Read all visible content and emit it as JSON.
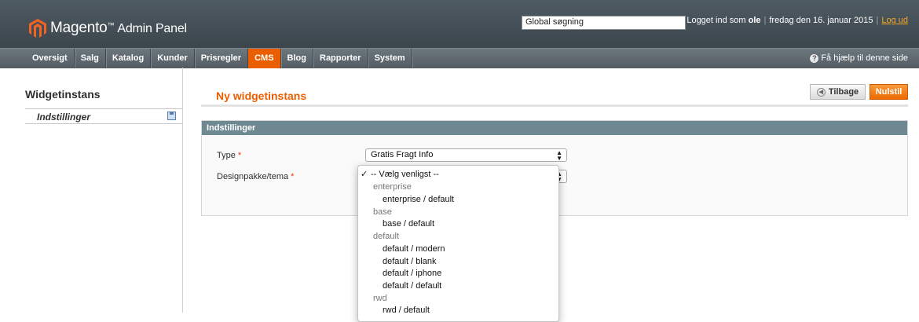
{
  "header": {
    "brand": "Magento",
    "brand_tm": "™",
    "brand_panel": "Admin Panel",
    "search_value": "Global søgning",
    "logged_in_prefix": "Logget ind som",
    "username": "ole",
    "date": "fredag den 16. januar 2015",
    "separator": "|",
    "logout": "Log ud"
  },
  "nav": {
    "items": [
      "Oversigt",
      "Salg",
      "Katalog",
      "Kunder",
      "Prisregler",
      "CMS",
      "Blog",
      "Rapporter",
      "System"
    ],
    "active": "CMS",
    "help": "Få hjælp til denne side"
  },
  "sidebar": {
    "title": "Widgetinstans",
    "tab_label": "Indstillinger"
  },
  "main": {
    "title": "Ny widgetinstans",
    "back_label": "Tilbage",
    "reset_label": "Nulstil",
    "fieldset_title": "Indstillinger",
    "type_label": "Type",
    "type_value": "Gratis Fragt Info",
    "design_label": "Designpakke/tema",
    "required_mark": "*"
  },
  "dropdown": {
    "check": "✓",
    "options": [
      {
        "text": "-- Vælg venligst --",
        "kind": "selected"
      },
      {
        "text": "enterprise",
        "kind": "group"
      },
      {
        "text": "enterprise / default",
        "kind": "option"
      },
      {
        "text": "base",
        "kind": "group"
      },
      {
        "text": "base / default",
        "kind": "option"
      },
      {
        "text": "default",
        "kind": "group"
      },
      {
        "text": "default / modern",
        "kind": "option"
      },
      {
        "text": "default / blank",
        "kind": "option"
      },
      {
        "text": "default / iphone",
        "kind": "option"
      },
      {
        "text": "default / default",
        "kind": "option"
      },
      {
        "text": "rwd",
        "kind": "group"
      },
      {
        "text": "rwd / default",
        "kind": "option"
      }
    ]
  },
  "colors": {
    "accent": "#eb5e00",
    "header_bg": "#434d54",
    "fieldset_head": "#6f8992"
  }
}
